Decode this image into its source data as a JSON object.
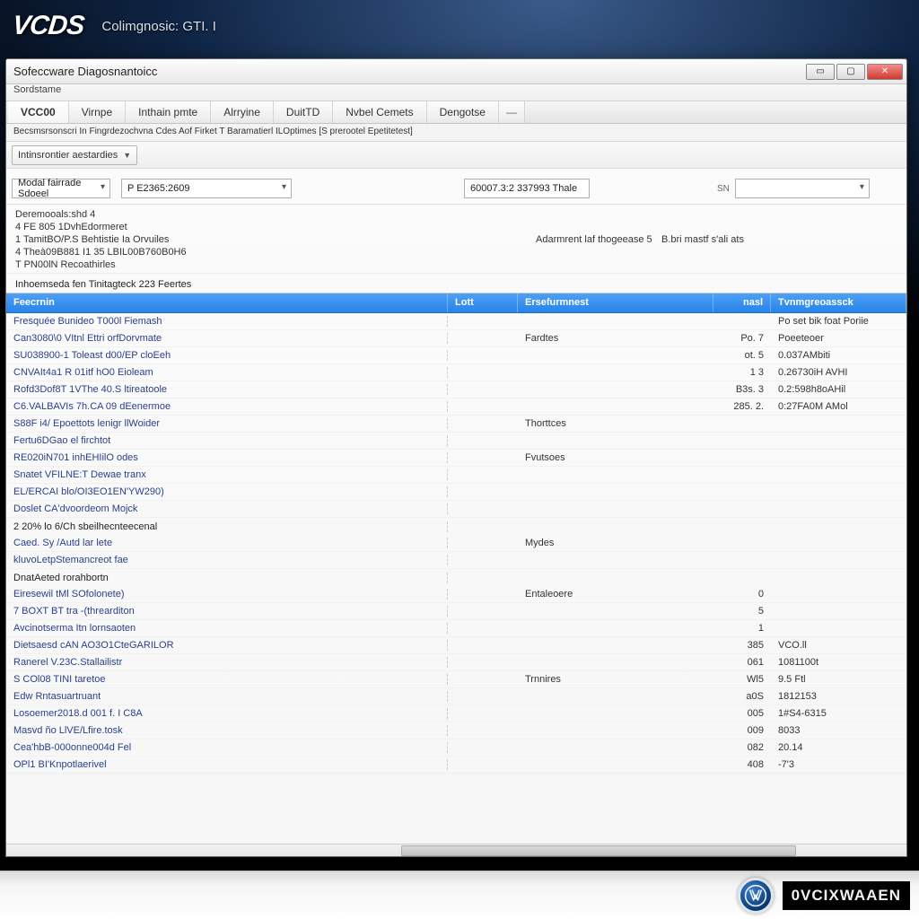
{
  "branding": {
    "logo": "VCDS",
    "subtitle": "Colimgnosic: GTI. I"
  },
  "window": {
    "title": "Sofeccware Diagosnantoicc",
    "subtitle": "Sordstame"
  },
  "tabs": [
    "VCC00",
    "Virnpe",
    "Inthain pmte",
    "Alrryine",
    "DuitTD",
    "Nvbel Cemets",
    "Dengotse"
  ],
  "breadcrumb": "Becsmsrsonscri In Fingrdezochvna Cdes Aof Firket T Baramatierl ILOptimes [S prerootel Epetitetest]",
  "toolbar": {
    "options_dd": "Intinsrontier aestardies"
  },
  "filters": {
    "module_label": "Modal fairrade Sdoeel",
    "module_value": "",
    "code_value": "P E2365:2609",
    "obj_value": "60007.3:2 337993 Thale",
    "sn_label": "SN",
    "sn_value": ""
  },
  "info": {
    "heading": "Deremooals:shd 4",
    "l1": "4 FE 805 1DvhEdormeret",
    "l2": "1 TamitBO/P.S Behtistie Ia Orvuiles",
    "l2_mid": "Adarmrent laf thogeease 5",
    "l2_right": "B.bri mastf s'ali ats",
    "l3": "4 Theà09B881 I1 35 LBIL00B760B0H6",
    "l4": "T PN00lN Recoathirles",
    "section": "Inhoemseda fen Tinitagteck 223 Feertes"
  },
  "columns": {
    "name": "Feecrnin",
    "unit": "Lott",
    "desc": "Ersefurmnest",
    "val": "nasl",
    "time": "Tvnmgreoassck"
  },
  "rows": [
    {
      "name": "Fresquée Bunideo T000l Fiemash",
      "unit": "",
      "desc": "",
      "val": "",
      "time": "Po set bik foat Poriie"
    },
    {
      "name": "Can3080\\0 VItnl Ettri orfDorvmate",
      "unit": "",
      "desc": "Fardtes",
      "val": "Po.  7",
      "time": "Poeeteoer"
    },
    {
      "name": "SU038900-1  Toleast d00/EP cloEeh",
      "unit": "",
      "desc": "",
      "val": "ot.  5",
      "time": "0.037AMbiti"
    },
    {
      "name": "CNVAIt4a1 R 01itf hO0 Eioleam",
      "unit": "",
      "desc": "",
      "val": "1  3",
      "time": "0.26730iH AVHI"
    },
    {
      "name": "Rofd3Dof8T 1VThe 40.S ltireatoole",
      "unit": "",
      "desc": "",
      "val": "B3s. 3",
      "time": "0.2:598h8oAHil"
    },
    {
      "name": "C6.VALBAVIs 7h.CA 09 dEenermoe",
      "unit": "",
      "desc": "",
      "val": "285. 2.",
      "time": "0:27FA0M AMol"
    },
    {
      "name": "S88F i4/ Epoettots lenigr llWoider",
      "unit": "",
      "desc": "Thorttces",
      "val": "",
      "time": ""
    },
    {
      "name": "Fertu6DGao el firchtot",
      "unit": "",
      "desc": "",
      "val": "",
      "time": ""
    },
    {
      "name": "RE020iN701 inhEHIilO odes",
      "unit": "",
      "desc": "Fvutsoes",
      "val": "",
      "time": ""
    },
    {
      "name": "Snatet VFILNE:T Dewae tranx",
      "unit": "",
      "desc": "",
      "val": "",
      "time": ""
    },
    {
      "name": "EL/ERCAI blo/OI3EO1EN'YW290)",
      "unit": "",
      "desc": "",
      "val": "",
      "time": ""
    },
    {
      "name": "Doslet CA'dvoordeom Mojck",
      "unit": "",
      "desc": "",
      "val": "",
      "time": ""
    },
    {
      "name": "2 20% lo 6/Ch sbeilhecnteecenal",
      "unit": "",
      "desc": "",
      "val": "",
      "time": "",
      "dark": true
    },
    {
      "name": "Caed. Sy /Autd lar lete",
      "unit": "",
      "desc": "Mydes",
      "val": "",
      "time": ""
    },
    {
      "name": "kluvoLetpStemancreot fae",
      "unit": "",
      "desc": "",
      "val": "",
      "time": ""
    },
    {
      "name": "DnatAeted rorahbortn",
      "unit": "",
      "desc": "",
      "val": "",
      "time": "",
      "dark": true
    },
    {
      "name": "Eiresewil tMl  SOfolonete)",
      "unit": "",
      "desc": "Entaleoere",
      "val": "0",
      "time": ""
    },
    {
      "name": "7 BOXT BT tra -(threarditon",
      "unit": "",
      "desc": "",
      "val": "5",
      "time": ""
    },
    {
      "name": "Avcinotserma Itn lornsaoten",
      "unit": "",
      "desc": "",
      "val": "1",
      "time": ""
    },
    {
      "name": "Dietsaesd cAN AO3O1CteGARILOR",
      "unit": "",
      "desc": "",
      "val": "385",
      "time": "VCO.ll"
    },
    {
      "name": "Ranerel V.23C.Stallailistr",
      "unit": "",
      "desc": "",
      "val": "061",
      "time": "1081100t"
    },
    {
      "name": "S COl08 TINI taretoe",
      "unit": "",
      "desc": "Trnnires",
      "val": "Wl5",
      "time": "9.5 Ftl"
    },
    {
      "name": "Edw Rntasuartruant",
      "unit": "",
      "desc": "",
      "val": "a0S",
      "time": "1812153"
    },
    {
      "name": "Losoemer2018.d 001 f. I C8A",
      "unit": "",
      "desc": "",
      "val": "005",
      "time": "1#S4-6315"
    },
    {
      "name": "Masvd ño LlVE/Lfire.tosk",
      "unit": "",
      "desc": "",
      "val": "009",
      "time": "8033"
    },
    {
      "name": "Cea'hbB-000onne004d Fel",
      "unit": "",
      "desc": "",
      "val": "082",
      "time": "20.14"
    },
    {
      "name": "OPl1 BI'Knpotlaerivel",
      "unit": "",
      "desc": "",
      "val": "408",
      "time": "-7'3"
    }
  ],
  "footer": {
    "brand": "0VCIXWAAEN"
  }
}
